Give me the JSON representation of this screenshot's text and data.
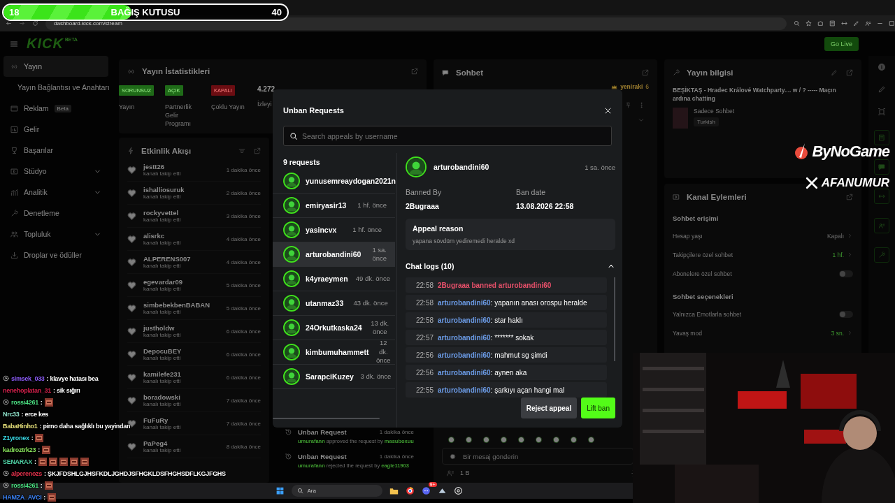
{
  "browser": {
    "url": "dashboard.kick.com/stream"
  },
  "donation_bar": {
    "current": "18",
    "title": "BAĞIŞ KUTUSU",
    "goal": "40",
    "level": 0.45
  },
  "header": {
    "logo": "KICK",
    "logo_tag": "BETA",
    "go_live": "Go Live"
  },
  "sidebar": {
    "items": [
      {
        "label": "Yayın",
        "kind": "broadcast",
        "selected": true,
        "has_submenu": false,
        "children": [
          {
            "label": "Yayın Bağlantısı ve Anahtarı",
            "selected": false
          }
        ]
      },
      {
        "label": "Reklam",
        "kind": "ads",
        "selected": false,
        "has_submenu": false,
        "badge": "Beta"
      },
      {
        "label": "Gelir",
        "kind": "income",
        "selected": false,
        "has_submenu": false
      },
      {
        "label": "Başarılar",
        "kind": "trophy",
        "selected": false,
        "has_submenu": false
      },
      {
        "label": "Stüdyo",
        "kind": "studio",
        "selected": false,
        "has_submenu": true
      },
      {
        "label": "Analitik",
        "kind": "analytics",
        "selected": false,
        "has_submenu": true
      },
      {
        "label": "Denetleme",
        "kind": "moderation",
        "selected": false,
        "has_submenu": false
      },
      {
        "label": "Topluluk",
        "kind": "community",
        "selected": false,
        "has_submenu": true
      },
      {
        "label": "Droplar ve ödüller",
        "kind": "drops",
        "selected": false,
        "has_submenu": false
      }
    ]
  },
  "stats": {
    "title": "Yayın İstatistikleri",
    "items": [
      {
        "kind": "badge",
        "badge": "SORUNSUZ",
        "color": "#1f6b18",
        "label": "Yayın"
      },
      {
        "kind": "badge",
        "badge": "AÇIK",
        "color": "#1f6b18",
        "label": "Partnerlik Gelir Programı"
      },
      {
        "kind": "badge",
        "badge": "KAPALI",
        "color": "#6b0d12",
        "label": "Çoklu Yayın"
      },
      {
        "kind": "number",
        "value": "4.272",
        "label": "İzleyi"
      }
    ]
  },
  "activity": {
    "title": "Etkinlik Akışı",
    "events": [
      {
        "user": "jestt26",
        "action": "kanalı takip etti",
        "time": "1 dakika önce"
      },
      {
        "user": "ishalliosuruk",
        "action": "kanalı takip etti",
        "time": "2 dakika önce"
      },
      {
        "user": "rockyvettel",
        "action": "kanalı takip etti",
        "time": "3 dakika önce"
      },
      {
        "user": "alisrkc",
        "action": "kanalı takip etti",
        "time": "4 dakika önce"
      },
      {
        "user": "ALPERENS007",
        "action": "kanalı takip etti",
        "time": "4 dakika önce"
      },
      {
        "user": "egevardar09",
        "action": "kanalı takip etti",
        "time": "5 dakika önce"
      },
      {
        "user": "simbebekbenBABAN",
        "action": "kanalı takip etti",
        "time": "5 dakika önce"
      },
      {
        "user": "justholdw",
        "action": "kanalı takip etti",
        "time": "6 dakika önce"
      },
      {
        "user": "DepocuBEY",
        "action": "kanalı takip etti",
        "time": "6 dakika önce"
      },
      {
        "user": "kamilefe231",
        "action": "kanalı takip etti",
        "time": "6 dakika önce"
      },
      {
        "user": "boradowski",
        "action": "kanalı takip etti",
        "time": "7 dakika önce"
      },
      {
        "user": "FuFuRy",
        "action": "kanalı takip etti",
        "time": "7 dakika önce"
      },
      {
        "user": "PaPeg4",
        "action": "kanalı takip etti",
        "time": "8 dakika önce"
      }
    ]
  },
  "mod_log": {
    "entries": [
      {
        "title": "Unban Request",
        "time": "1 dakika önce",
        "actor": "umurafann",
        "verb": " approved the request by ",
        "target": "masuboxuu"
      },
      {
        "title": "Unban Request",
        "time": "1 dakika önce",
        "actor": "umurafann",
        "verb": " rejected the request by ",
        "target": "eagle11903"
      }
    ]
  },
  "chat_panel": {
    "title": "Sohbet",
    "pinned_users": [
      {
        "name": "yeniraki",
        "count": "6"
      }
    ],
    "input_placeholder": "Bir mesaj gönderin",
    "viewers": "1 B"
  },
  "stream_info": {
    "title": "Yayın bilgisi",
    "stream_title": "BEŞİKTAŞ - Hradec Králové Watchparty.... w / ? ----- Maçın ardına chatting",
    "category": "Sadece Sohbet",
    "language": "Turkish"
  },
  "channel_actions": {
    "title": "Kanal Eylemleri",
    "sections": [
      {
        "title": "Sohbet erişimi",
        "rows": [
          {
            "label": "Hesap yaşı",
            "kind": "link",
            "value": "Kapalı",
            "active": false
          },
          {
            "label": "Takipçilere özel sohbet",
            "kind": "link",
            "value": "1 hf.",
            "active": true
          },
          {
            "label": "Abonelere özel sohbet",
            "kind": "toggle",
            "on": false
          }
        ]
      },
      {
        "title": "Sohbet seçenekleri",
        "rows": [
          {
            "label": "Yalnızca Emotlarla sohbet",
            "kind": "toggle",
            "on": false
          },
          {
            "label": "Yavaş mod",
            "kind": "link",
            "value": "3 sn.",
            "active": true
          }
        ]
      }
    ]
  },
  "modal": {
    "title": "Unban Requests",
    "search_placeholder": "Search appeals by username",
    "count_label": "9 requests",
    "requests": [
      {
        "user": "yunusemreaydogan2021n",
        "selected": false
      },
      {
        "user": "emiryasir13",
        "time": "1 hf. önce",
        "selected": false
      },
      {
        "user": "yasincvx",
        "time": "1 hf. önce",
        "selected": false
      },
      {
        "user": "arturobandini60",
        "time": "1 sa. önce",
        "selected": true
      },
      {
        "user": "k4yraeymen",
        "time": "49 dk. önce",
        "selected": false
      },
      {
        "user": "utanmaz33",
        "time": "43 dk. önce",
        "selected": false
      },
      {
        "user": "24Orkutkaska24",
        "time": "13 dk. önce",
        "selected": false
      },
      {
        "user": "kimbumuhammett",
        "time": "12 dk. önce",
        "selected": false
      },
      {
        "user": "SarapciKuzey",
        "time": "3 dk. önce",
        "selected": false
      }
    ],
    "detail": {
      "user": "arturobandini60",
      "time": "1 sa. önce",
      "banned_by_label": "Banned By",
      "banned_by": "2Bugraaa",
      "ban_date_label": "Ban date",
      "ban_date": "13.08.2026 22:58",
      "appeal_label": "Appeal reason",
      "appeal_text": "yapana sövdüm yediremedi heralde xd",
      "logs_label": "Chat logs (10)",
      "logs_expanded": true,
      "logs": [
        {
          "kind": "ban",
          "time": "22:58",
          "text": "2Bugraaa banned arturobandini60"
        },
        {
          "kind": "message",
          "time": "22:58",
          "user": "arturobandini60",
          "text": ": yapanın anası orospu heralde"
        },
        {
          "kind": "message",
          "time": "22:58",
          "user": "arturobandini60",
          "text": ": star haklı"
        },
        {
          "kind": "message",
          "time": "22:57",
          "user": "arturobandini60",
          "text": ": ******* sokak"
        },
        {
          "kind": "message",
          "time": "22:56",
          "user": "arturobandini60",
          "text": ": mahmut sg şimdi"
        },
        {
          "kind": "message",
          "time": "22:56",
          "user": "arturobandini60",
          "text": ": aynen aka"
        },
        {
          "kind": "message",
          "time": "22:55",
          "user": "arturobandini60",
          "text": ": şarkıyı açan hangi mal"
        }
      ]
    },
    "buttons": [
      {
        "label": "Reject appeal",
        "kind": "secondary"
      },
      {
        "label": "Lift ban",
        "kind": "primary"
      }
    ]
  },
  "overlay_chat": {
    "messages": [
      {
        "user": "simsek_033",
        "color": "#8b5cf6",
        "badge": true,
        "text": ": klavye hatası bea"
      },
      {
        "user": "nenehoplatan_31",
        "color": "#d0204a",
        "badge": false,
        "text": ": sik sığırı"
      },
      {
        "user": "rossi4261",
        "color": "#4ade80",
        "badge": true,
        "text": ":"
      },
      {
        "user": "Nrc33",
        "color": "#8de0c8",
        "badge": false,
        "text": ": erce kes"
      },
      {
        "user": "BabaHinho1",
        "color": "#e6e07a",
        "badge": false,
        "text": ": pirno daha sağlıklı bu yayindan"
      },
      {
        "user": "Z1yronex",
        "color": "#38d9e6",
        "badge": false,
        "text": ":"
      },
      {
        "user": "kadroztrk23",
        "color": "#86e05a",
        "badge": false,
        "text": ":"
      },
      {
        "user": "SENARAX",
        "color": "#4fd1a5",
        "badge": false,
        "text": ":"
      },
      {
        "user": "alperenozs",
        "color": "#e0304a",
        "badge": true,
        "text": ": ŞKJFDSHLGJHSFKDLJGHDJSFHGKLDSFHGHSDFLKGJFGHS"
      },
      {
        "user": "rossi4261",
        "color": "#4ade80",
        "badge": true,
        "text": ":"
      },
      {
        "user": "HAMZA_AVCI",
        "color": "#3b82f6",
        "badge": false,
        "text": ":"
      }
    ]
  },
  "brand_overlay": {
    "logos": [
      {
        "kind": "bynogame",
        "text": "ByNoGame"
      },
      {
        "kind": "x",
        "text": "AFANUMUR"
      }
    ]
  },
  "taskbar": {
    "search_placeholder": "Ara",
    "discord_badge": "9+"
  }
}
